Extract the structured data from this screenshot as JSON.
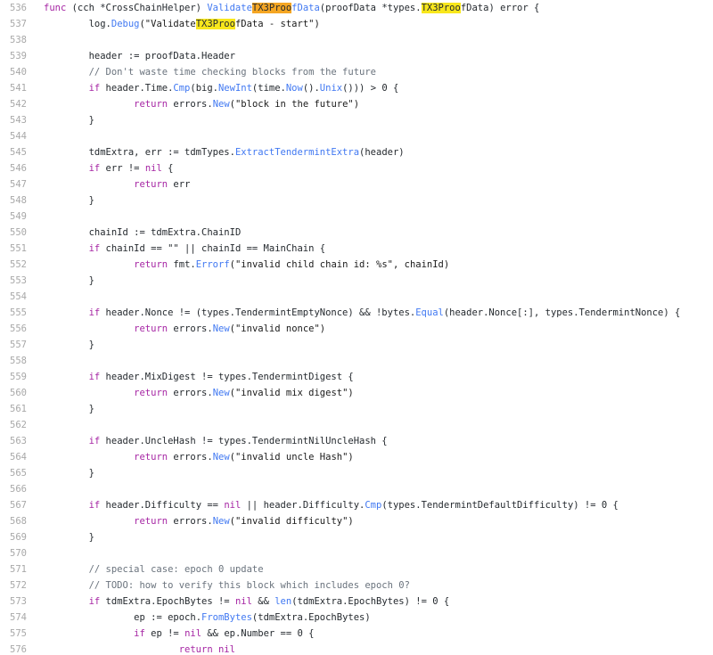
{
  "editor": {
    "indent": "        ",
    "lines": [
      {
        "n": "536",
        "tokens": [
          {
            "t": "func ",
            "c": "kw"
          },
          {
            "t": "(cch *CrossChainHelper) ",
            "c": "txt"
          },
          {
            "t": "Validate",
            "c": "fn"
          },
          {
            "t": "TX3Proo",
            "c": "hlo"
          },
          {
            "t": "fData",
            "c": "fn"
          },
          {
            "t": "(proofData *types.",
            "c": "txt"
          },
          {
            "t": "TX3Proo",
            "c": "hl"
          },
          {
            "t": "fData) error {",
            "c": "txt"
          }
        ]
      },
      {
        "n": "537",
        "indent": 1,
        "tokens": [
          {
            "t": "log.",
            "c": "txt"
          },
          {
            "t": "Debug",
            "c": "fn"
          },
          {
            "t": "(\"Validate",
            "c": "str"
          },
          {
            "t": "TX3Proo",
            "c": "hl"
          },
          {
            "t": "fData - start\")",
            "c": "str"
          }
        ]
      },
      {
        "n": "538",
        "tokens": []
      },
      {
        "n": "539",
        "indent": 1,
        "tokens": [
          {
            "t": "header := proofData.Header",
            "c": "txt"
          }
        ]
      },
      {
        "n": "540",
        "indent": 1,
        "tokens": [
          {
            "t": "// Don't waste time checking blocks from the future",
            "c": "com"
          }
        ]
      },
      {
        "n": "541",
        "indent": 1,
        "tokens": [
          {
            "t": "if ",
            "c": "kw"
          },
          {
            "t": "header.Time.",
            "c": "txt"
          },
          {
            "t": "Cmp",
            "c": "fn"
          },
          {
            "t": "(big.",
            "c": "txt"
          },
          {
            "t": "NewInt",
            "c": "fn"
          },
          {
            "t": "(time.",
            "c": "txt"
          },
          {
            "t": "Now",
            "c": "fn"
          },
          {
            "t": "().",
            "c": "txt"
          },
          {
            "t": "Unix",
            "c": "fn"
          },
          {
            "t": "())) > 0 {",
            "c": "txt"
          }
        ]
      },
      {
        "n": "542",
        "indent": 2,
        "tokens": [
          {
            "t": "return ",
            "c": "kw"
          },
          {
            "t": "errors.",
            "c": "txt"
          },
          {
            "t": "New",
            "c": "fn"
          },
          {
            "t": "(\"block in the future\")",
            "c": "str"
          }
        ]
      },
      {
        "n": "543",
        "indent": 1,
        "tokens": [
          {
            "t": "}",
            "c": "txt"
          }
        ]
      },
      {
        "n": "544",
        "tokens": []
      },
      {
        "n": "545",
        "indent": 1,
        "tokens": [
          {
            "t": "tdmExtra, err := tdmTypes.",
            "c": "txt"
          },
          {
            "t": "ExtractTendermintExtra",
            "c": "fn"
          },
          {
            "t": "(header)",
            "c": "txt"
          }
        ]
      },
      {
        "n": "546",
        "indent": 1,
        "tokens": [
          {
            "t": "if ",
            "c": "kw"
          },
          {
            "t": "err != ",
            "c": "txt"
          },
          {
            "t": "nil",
            "c": "kw"
          },
          {
            "t": " {",
            "c": "txt"
          }
        ]
      },
      {
        "n": "547",
        "indent": 2,
        "tokens": [
          {
            "t": "return ",
            "c": "kw"
          },
          {
            "t": "err",
            "c": "txt"
          }
        ]
      },
      {
        "n": "548",
        "indent": 1,
        "tokens": [
          {
            "t": "}",
            "c": "txt"
          }
        ]
      },
      {
        "n": "549",
        "tokens": []
      },
      {
        "n": "550",
        "indent": 1,
        "tokens": [
          {
            "t": "chainId := tdmExtra.ChainID",
            "c": "txt"
          }
        ]
      },
      {
        "n": "551",
        "indent": 1,
        "tokens": [
          {
            "t": "if ",
            "c": "kw"
          },
          {
            "t": "chainId == \"\" || chainId == MainChain {",
            "c": "txt"
          }
        ]
      },
      {
        "n": "552",
        "indent": 2,
        "tokens": [
          {
            "t": "return ",
            "c": "kw"
          },
          {
            "t": "fmt.",
            "c": "txt"
          },
          {
            "t": "Errorf",
            "c": "fn"
          },
          {
            "t": "(\"invalid child chain id: %s\", chainId)",
            "c": "str"
          }
        ]
      },
      {
        "n": "553",
        "indent": 1,
        "tokens": [
          {
            "t": "}",
            "c": "txt"
          }
        ]
      },
      {
        "n": "554",
        "tokens": []
      },
      {
        "n": "555",
        "indent": 1,
        "tokens": [
          {
            "t": "if ",
            "c": "kw"
          },
          {
            "t": "header.Nonce != (types.TendermintEmptyNonce) && !bytes.",
            "c": "txt"
          },
          {
            "t": "Equal",
            "c": "fn"
          },
          {
            "t": "(header.Nonce[:], types.TendermintNonce) {",
            "c": "txt"
          }
        ]
      },
      {
        "n": "556",
        "indent": 2,
        "tokens": [
          {
            "t": "return ",
            "c": "kw"
          },
          {
            "t": "errors.",
            "c": "txt"
          },
          {
            "t": "New",
            "c": "fn"
          },
          {
            "t": "(\"invalid nonce\")",
            "c": "str"
          }
        ]
      },
      {
        "n": "557",
        "indent": 1,
        "tokens": [
          {
            "t": "}",
            "c": "txt"
          }
        ]
      },
      {
        "n": "558",
        "tokens": []
      },
      {
        "n": "559",
        "indent": 1,
        "tokens": [
          {
            "t": "if ",
            "c": "kw"
          },
          {
            "t": "header.MixDigest != types.TendermintDigest {",
            "c": "txt"
          }
        ]
      },
      {
        "n": "560",
        "indent": 2,
        "tokens": [
          {
            "t": "return ",
            "c": "kw"
          },
          {
            "t": "errors.",
            "c": "txt"
          },
          {
            "t": "New",
            "c": "fn"
          },
          {
            "t": "(\"invalid mix digest\")",
            "c": "str"
          }
        ]
      },
      {
        "n": "561",
        "indent": 1,
        "tokens": [
          {
            "t": "}",
            "c": "txt"
          }
        ]
      },
      {
        "n": "562",
        "tokens": []
      },
      {
        "n": "563",
        "indent": 1,
        "tokens": [
          {
            "t": "if ",
            "c": "kw"
          },
          {
            "t": "header.UncleHash != types.TendermintNilUncleHash {",
            "c": "txt"
          }
        ]
      },
      {
        "n": "564",
        "indent": 2,
        "tokens": [
          {
            "t": "return ",
            "c": "kw"
          },
          {
            "t": "errors.",
            "c": "txt"
          },
          {
            "t": "New",
            "c": "fn"
          },
          {
            "t": "(\"invalid uncle Hash\")",
            "c": "str"
          }
        ]
      },
      {
        "n": "565",
        "indent": 1,
        "tokens": [
          {
            "t": "}",
            "c": "txt"
          }
        ]
      },
      {
        "n": "566",
        "tokens": []
      },
      {
        "n": "567",
        "indent": 1,
        "tokens": [
          {
            "t": "if ",
            "c": "kw"
          },
          {
            "t": "header.Difficulty == ",
            "c": "txt"
          },
          {
            "t": "nil",
            "c": "kw"
          },
          {
            "t": " || header.Difficulty.",
            "c": "txt"
          },
          {
            "t": "Cmp",
            "c": "fn"
          },
          {
            "t": "(types.TendermintDefaultDifficulty) != 0 {",
            "c": "txt"
          }
        ]
      },
      {
        "n": "568",
        "indent": 2,
        "tokens": [
          {
            "t": "return ",
            "c": "kw"
          },
          {
            "t": "errors.",
            "c": "txt"
          },
          {
            "t": "New",
            "c": "fn"
          },
          {
            "t": "(\"invalid difficulty\")",
            "c": "str"
          }
        ]
      },
      {
        "n": "569",
        "indent": 1,
        "tokens": [
          {
            "t": "}",
            "c": "txt"
          }
        ]
      },
      {
        "n": "570",
        "tokens": []
      },
      {
        "n": "571",
        "indent": 1,
        "tokens": [
          {
            "t": "// special case: epoch 0 update",
            "c": "com"
          }
        ]
      },
      {
        "n": "572",
        "indent": 1,
        "tokens": [
          {
            "t": "// TODO: how to verify this block which includes epoch 0?",
            "c": "com"
          }
        ]
      },
      {
        "n": "573",
        "indent": 1,
        "tokens": [
          {
            "t": "if ",
            "c": "kw"
          },
          {
            "t": "tdmExtra.EpochBytes != ",
            "c": "txt"
          },
          {
            "t": "nil",
            "c": "kw"
          },
          {
            "t": " && ",
            "c": "txt"
          },
          {
            "t": "len",
            "c": "fn"
          },
          {
            "t": "(tdmExtra.EpochBytes) != 0 {",
            "c": "txt"
          }
        ]
      },
      {
        "n": "574",
        "indent": 2,
        "tokens": [
          {
            "t": "ep := epoch.",
            "c": "txt"
          },
          {
            "t": "FromBytes",
            "c": "fn"
          },
          {
            "t": "(tdmExtra.EpochBytes)",
            "c": "txt"
          }
        ]
      },
      {
        "n": "575",
        "indent": 2,
        "tokens": [
          {
            "t": "if ",
            "c": "kw"
          },
          {
            "t": "ep != ",
            "c": "txt"
          },
          {
            "t": "nil",
            "c": "kw"
          },
          {
            "t": " && ep.Number == 0 {",
            "c": "txt"
          }
        ]
      },
      {
        "n": "576",
        "indent": 3,
        "tokens": [
          {
            "t": "return ",
            "c": "kw"
          },
          {
            "t": "nil",
            "c": "kw"
          }
        ]
      }
    ]
  }
}
